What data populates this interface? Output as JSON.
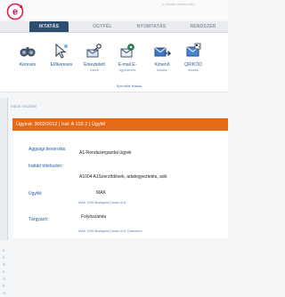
{
  "app": {
    "top_right_info": "e-iktatás felhasználó"
  },
  "tabs": [
    {
      "label": "IKTATÁS",
      "active": true
    },
    {
      "label": "ÜGYFÉL",
      "active": false
    },
    {
      "label": "NYOMTATÁS",
      "active": false
    },
    {
      "label": "RENDSZER",
      "active": false
    }
  ],
  "toolbar": {
    "buttons": [
      {
        "label": "Keresés",
        "sub": "",
        "icon": "binoculars-icon"
      },
      {
        "label": "Előkeresés",
        "sub": "",
        "icon": "cursor-arrow-icon"
      },
      {
        "label": "Érkeztetett",
        "sub": "iratok",
        "icon": "inbox-scissors-icon"
      },
      {
        "label": "E-mail E-",
        "sub": "ügyintézés",
        "icon": "email-gear-icon"
      },
      {
        "label": "Kimenő",
        "sub": "iktatás",
        "icon": "outgoing-mail-icon"
      },
      {
        "label": "QR/KÓD",
        "sub": "iktatás",
        "icon": "qr-mail-icon"
      }
    ],
    "group_label": "Speciális iktatás"
  },
  "breadcrumb": "Iratok részletei",
  "side_letters": [
    "K",
    "E",
    "R",
    "E",
    "S",
    "É",
    "S"
  ],
  "record": {
    "header": "Ügyirat: 3002/2012 | Irat: A 103 2 | Ügyfél",
    "fields": [
      {
        "label": "Aggsági besorolás:",
        "value": "A1-Rendszergazdai ügyek"
      },
      {
        "label": "Irattári tételszám:",
        "value": "A1004 A1Szerződések, adategyeztetés, adó"
      },
      {
        "label": "Ügyfél:",
        "value": "MAK",
        "sub": "MAK 1050 Budapest Lisszt út 6."
      },
      {
        "label": "Tárgyazó:",
        "value": "Folyószámla",
        "sub": "MAK 1050 Budapest Lisszt út 6. Debrecen"
      }
    ]
  }
}
